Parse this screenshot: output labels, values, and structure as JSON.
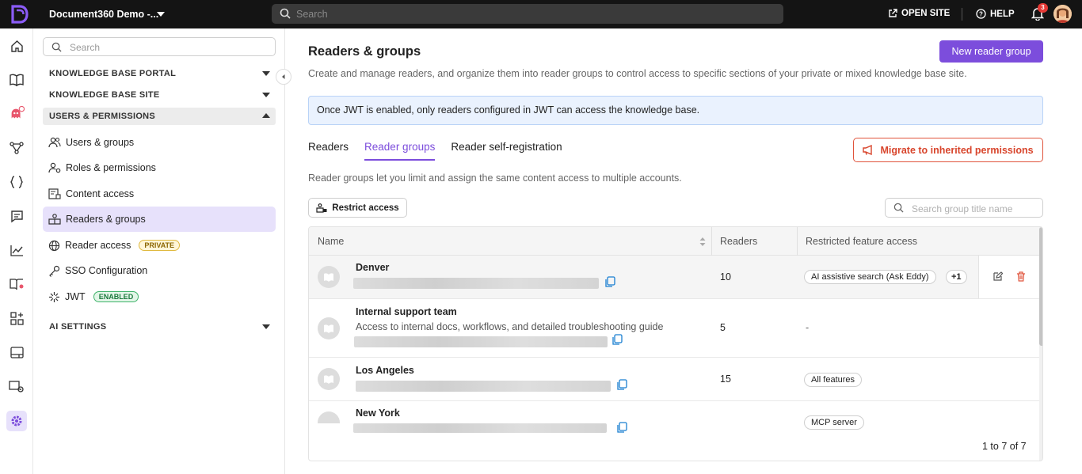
{
  "topbar": {
    "project_name": "Document360 Demo -...",
    "search_placeholder": "Search",
    "open_site": "OPEN SITE",
    "help": "HELP",
    "notification_count": "3"
  },
  "rail": {
    "icons": [
      "home-icon",
      "book-icon",
      "eddy-ai-icon",
      "workflow-icon",
      "api-icon",
      "feedback-icon",
      "analytics-icon",
      "knowledge-icon",
      "apps-icon",
      "widget-icon",
      "site-settings-icon",
      "settings-icon"
    ],
    "active": "settings-icon"
  },
  "sidebar": {
    "search_placeholder": "Search",
    "sections": {
      "kb_portal": "KNOWLEDGE BASE PORTAL",
      "kb_site": "KNOWLEDGE BASE SITE",
      "users_permissions": "USERS & PERMISSIONS",
      "ai_settings": "AI SETTINGS"
    },
    "items": [
      {
        "label": "Users & groups"
      },
      {
        "label": "Roles & permissions"
      },
      {
        "label": "Content access"
      },
      {
        "label": "Readers & groups"
      },
      {
        "label": "Reader access",
        "tag": "PRIVATE"
      },
      {
        "label": "SSO Configuration"
      },
      {
        "label": "JWT",
        "tag": "ENABLED"
      }
    ]
  },
  "main": {
    "title": "Readers & groups",
    "new_button": "New reader group",
    "subtitle": "Create and manage readers, and organize them into reader groups to control access to specific sections of your private or mixed knowledge base site.",
    "alert": "Once JWT is enabled, only readers configured in JWT can access the knowledge base.",
    "tabs": [
      "Readers",
      "Reader groups",
      "Reader self-registration"
    ],
    "active_tab": "Reader groups",
    "migrate_button": "Migrate to inherited permissions",
    "description": "Reader groups let you limit and assign the same content access to multiple accounts.",
    "restrict_button": "Restrict access",
    "group_search_placeholder": "Search group title name",
    "columns": [
      "Name",
      "Readers",
      "Restricted feature access"
    ],
    "rows": [
      {
        "name": "Denver",
        "description": "",
        "readers": "10",
        "features": [
          "AI assistive search (Ask Eddy)"
        ],
        "more": "+1"
      },
      {
        "name": "Internal support team",
        "description": "Access to internal docs, workflows, and detailed troubleshooting guide",
        "readers": "5",
        "features": [],
        "none": "-"
      },
      {
        "name": "Los Angeles",
        "description": "",
        "readers": "15",
        "features": [
          "All features"
        ]
      },
      {
        "name": "New York",
        "description": "",
        "readers": "",
        "features": [
          "MCP server"
        ]
      }
    ],
    "pagination": "1 to 7 of 7"
  },
  "colors": {
    "accent": "#7c4ddc",
    "danger": "#d8452c",
    "topbar": "#141414"
  }
}
